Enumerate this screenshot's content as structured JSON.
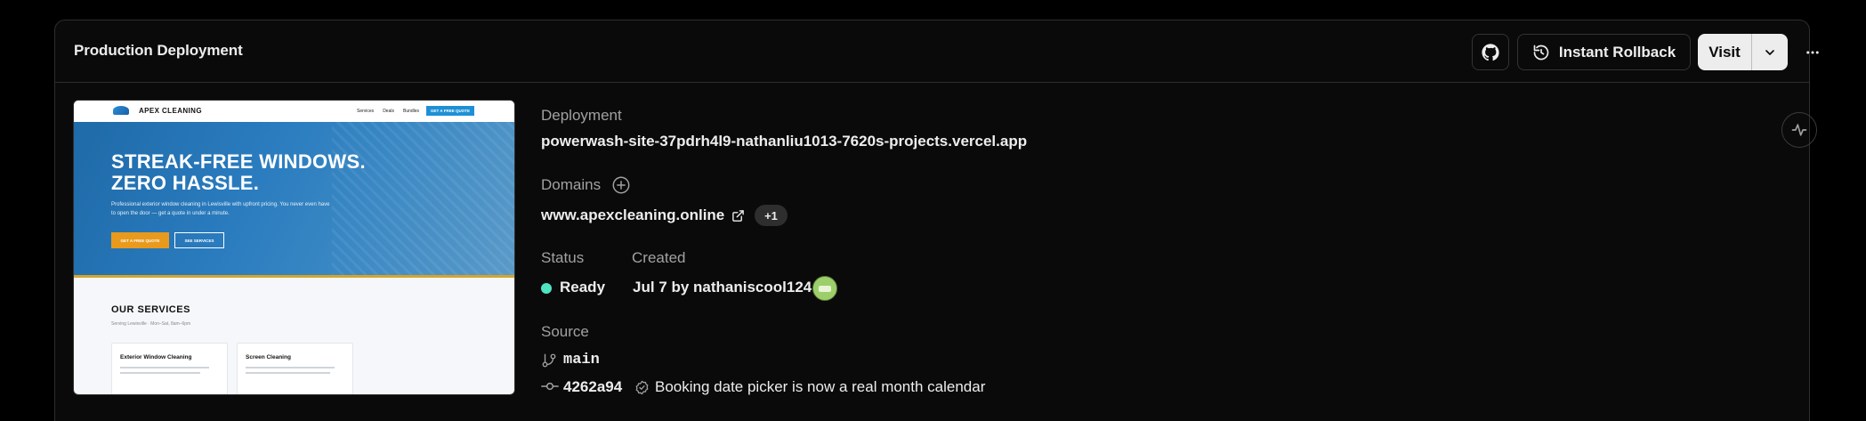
{
  "header": {
    "title": "Production Deployment",
    "github_icon": "github-icon",
    "rollback_label": "Instant Rollback",
    "visit_label": "Visit",
    "more_icon": "more-horizontal-icon"
  },
  "preview": {
    "brand": "APEX CLEANING",
    "nav_links": [
      "Services",
      "Deals",
      "Bundles"
    ],
    "nav_cta": "GET A FREE QUOTE",
    "headline": "STREAK-FREE WINDOWS. ZERO HASSLE.",
    "subtext": "Professional exterior window cleaning in Lewisville with upfront pricing. You never even have to open the door — get a quote in under a minute.",
    "hero_btn_primary": "GET A FREE QUOTE",
    "hero_btn_secondary": "SEE SERVICES",
    "services_title": "OUR SERVICES",
    "services_sub": "Serving Lewisville · Mon–Sat, 8am–6pm",
    "services": [
      "Exterior Window Cleaning",
      "Screen Cleaning"
    ]
  },
  "details": {
    "deployment_label": "Deployment",
    "deployment_url": "powerwash-site-37pdrh4l9-nathanliu1013-7620s-projects.vercel.app",
    "domains_label": "Domains",
    "domain": "www.apexcleaning.online",
    "domain_extra": "+1",
    "status_label": "Status",
    "status_value": "Ready",
    "status_color": "#50e3c2",
    "created_label": "Created",
    "created_value": "Jul 7 by nathaniscool124",
    "source_label": "Source",
    "branch": "main",
    "commit_hash": "4262a94",
    "commit_message": "Booking date picker is now a real month calendar"
  }
}
